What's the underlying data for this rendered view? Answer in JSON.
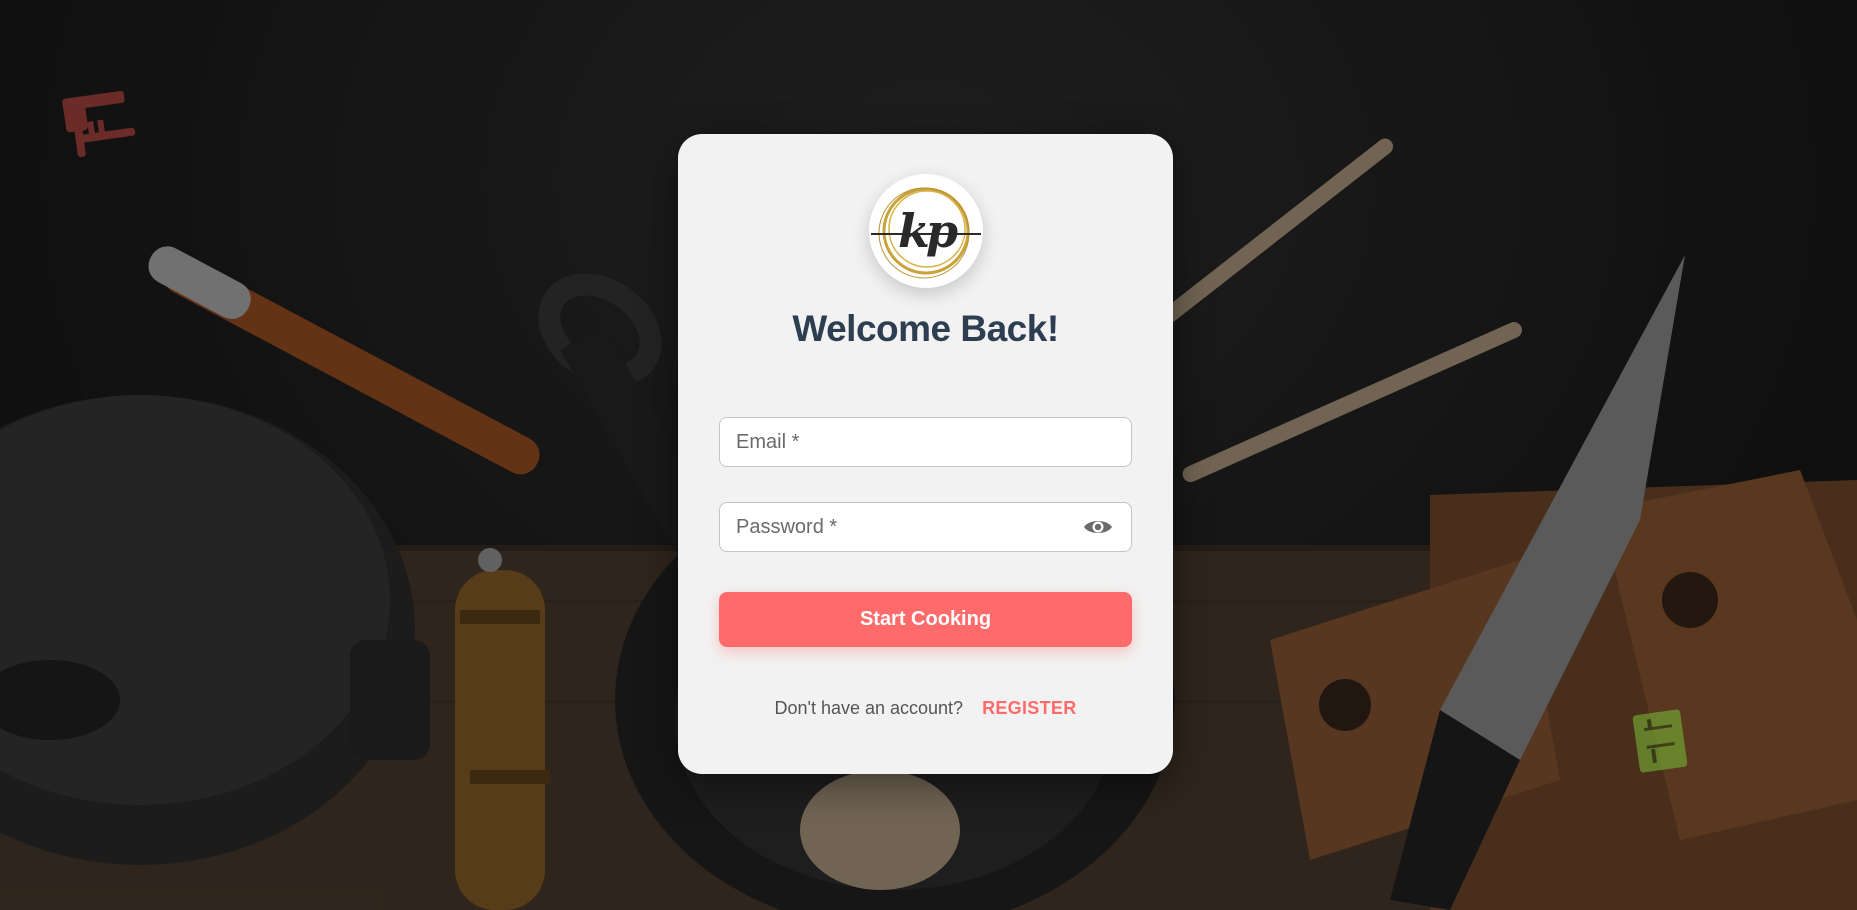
{
  "login": {
    "title": "Welcome Back!",
    "logo_text": "kp",
    "email_placeholder": "Email *",
    "password_placeholder": "Password *",
    "submit_label": "Start Cooking",
    "footer_question": "Don't have an account?",
    "register_label": "REGISTER"
  },
  "icons": {
    "logo": "kp-monogram-logo",
    "password_toggle": "eye-icon",
    "decor_top_left": "fork-knife-icon",
    "decor_bottom_right": "green-box-icon"
  },
  "colors": {
    "accent": "#ff6b6b",
    "title": "#2c3e50",
    "card": "#f2f2f2",
    "logo_ring": "#c9a23b"
  }
}
